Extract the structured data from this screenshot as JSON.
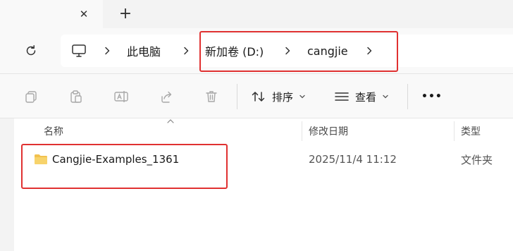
{
  "tabs": {
    "close_glyph": "✕",
    "new_tab_glyph": "+"
  },
  "breadcrumb": {
    "items": [
      "此电脑",
      "新加卷 (D:)",
      "cangjie"
    ]
  },
  "toolbar": {
    "sort_label": "排序",
    "view_label": "查看",
    "more_glyph": "•••"
  },
  "columns": {
    "name": "名称",
    "modified": "修改日期",
    "type": "类型"
  },
  "files": [
    {
      "name": "Cangjie-Examples_1361",
      "modified": "2025/11/4 11:12",
      "type": "文件夹"
    }
  ],
  "colors": {
    "highlight": "#e03131",
    "folder": "#f2c14e"
  }
}
